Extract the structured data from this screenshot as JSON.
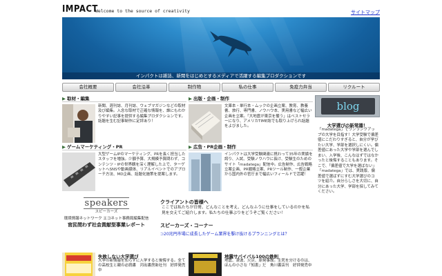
{
  "header": {
    "logo": "IMPACT",
    "tagline": "Welcome to the source of creativity",
    "sitemap": "サイトマップ"
  },
  "hero": {
    "caption": "インパクトは雑誌、新聞をはじめとするメディアで活躍する編集プロダクションです"
  },
  "nav": [
    "会社概要",
    "会社沿革",
    "制作物",
    "私の仕事",
    "免疫力弁当",
    "リクルート"
  ],
  "panels": {
    "editing": {
      "title": "取材・編集",
      "text": "新聞、週刊誌、月刊誌、ウェブマガジンなどの取材及び編集。入念な取材で正確な情報を、誰にもわかりやすい記事を提供する編集プロダクションです。話題を生む記事制作に定評あり！"
    },
    "publishing": {
      "title": "出版・企画・制作",
      "text": "文庫本・単行本・ムックの企画立案、教育、教養書、旅行、専門書、ノウハウ本、実用書など幅広い企画を立案。「大地震が東京を襲う」はベストセラーになり、アメリカTIME誌でも取り上げられ話題をよびました。"
    },
    "game": {
      "title": "ゲームマーケティング・PR",
      "text": "大型ゲームIPのマーケティング、PRを長く担当したスタッフを増強。少額予算、大規模予算問わず、コンテンツ・IPの世界観を深く理解した上で、ターゲットへSNSや動画媒体、リアルイベントでのアプローチ方法、MD企画、話題化施策を提案します。"
    },
    "ad": {
      "title": "広告・PR企画・制作",
      "text": "インパクトは大学受験関連に携わって35年の実績を誇り、入試、受験ノウハウに長け、受験生のためのサイト「madatega」配信中。広告制作、広告戦略立案企画、PR戦略立案、PRツール制作、一般企業から国内外の官庁まで幅広いフィールドで活躍！"
    }
  },
  "speakers": {
    "logo": "speakers",
    "kana": "スピーカーズ",
    "network": "環境情報ネットワーク エコネット事務局編集配信",
    "title": "官民問わず社会貢献型事業レポート"
  },
  "client": {
    "heading": "クライアントの皆様へ",
    "text": "ここでは私たちが日常、どんなことを考え、どんなふうに仕事をしているのかを私見を交えてご紹介します。私たちの仕事ぶりをどうぞご覧ください！",
    "corner_heading": "スピーカーズ・コーナー",
    "link": "20兆円市場に成長したゲーム業界を駆け抜けるプランニングとは？"
  },
  "books": [
    {
      "title": "失敗しない大学選び",
      "text": "大学の新情報を知らずに入学すると後悔する。全ての高校生と親の必読書　河出書房新社刊　好評発売中"
    },
    {
      "title": "地震サバイバル100の鉄則",
      "text": "地震、津波、火災、原発事故。生死を分けるのは、ほんの小さな「知恵」だ　角川書店刊　好評発売中"
    }
  ],
  "sidebar": {
    "blog": "blog",
    "heading": "大学選びの新常識！",
    "text": "「madatega」でワンランクアップの大学を目指す！大学受験で偏差値にこだわりすぎると、自分が学びたい大学、学部を選択しにくい。偏差値にあった大学や学部を選んでしまい、入学後、こんなはずではなかったと後悔することもあります。そこで、「偏差値で大学を選ばない」「madatega」では、実践版、偏差値で選ばずにすむ大学選びのコツを紹介。自分らしさを大切に、自分にあった大学、学部を探してみてください。"
  },
  "colors": {
    "link": "#1a2fcc",
    "sea_top": "#6fc2ee",
    "sea_bottom": "#0c4c82",
    "blog_text": "#7fd8f0"
  }
}
